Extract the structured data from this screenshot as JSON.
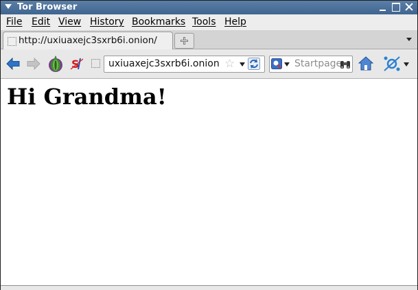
{
  "window": {
    "title": "Tor Browser"
  },
  "menu": {
    "file": "File",
    "edit": "Edit",
    "view": "View",
    "history": "History",
    "bookmarks": "Bookmarks",
    "tools": "Tools",
    "help": "Help"
  },
  "tabs": [
    {
      "label": "http://uxiuaxejc3sxrb6i.onion/",
      "active": true
    }
  ],
  "navbar": {
    "url": "uxiuaxejc3sxrb6i.onion",
    "search_placeholder": "Startpage"
  },
  "icons": {
    "back": "back-arrow-icon",
    "forward": "forward-arrow-icon",
    "tor_onion": "tor-onion-icon",
    "https_everywhere": "script-s-icon",
    "site_identity": "site-identity-icon",
    "bookmark_star": "star-icon",
    "reload": "reload-icon",
    "search_engine": "search-engine-icon",
    "search_go": "binoculars-icon",
    "home": "home-icon",
    "torbutton": "torbutton-icon"
  },
  "colors": {
    "titlebar": "#4a6f97",
    "back_arrow": "#2e74c7",
    "content_bg": "#ffffff"
  },
  "page": {
    "heading": "Hi Grandma!"
  }
}
